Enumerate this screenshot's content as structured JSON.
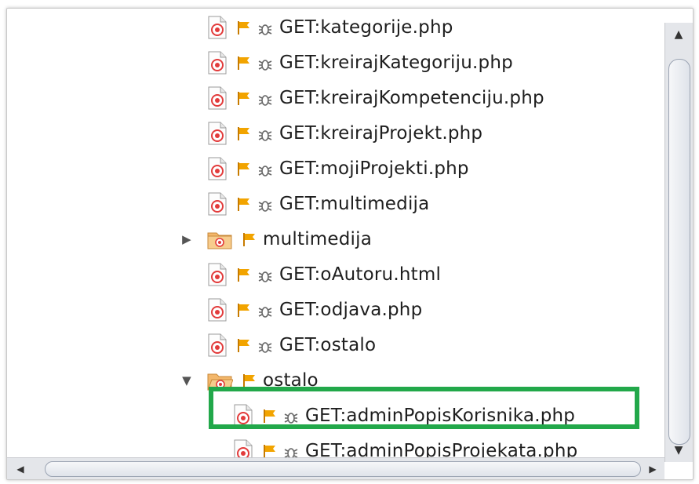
{
  "tree": {
    "rows": [
      {
        "label": "GET:kategorije.php",
        "type": "file",
        "icons": [
          "page-target-icon",
          "flag-icon",
          "bug-icon"
        ]
      },
      {
        "label": "GET:kreirajKategoriju.php",
        "type": "file",
        "icons": [
          "page-target-icon",
          "flag-icon",
          "bug-icon"
        ]
      },
      {
        "label": "GET:kreirajKompetenciju.php",
        "type": "file",
        "icons": [
          "page-target-icon",
          "flag-icon",
          "bug-icon"
        ]
      },
      {
        "label": "GET:kreirajProjekt.php",
        "type": "file",
        "icons": [
          "page-target-icon",
          "flag-icon",
          "bug-icon"
        ]
      },
      {
        "label": "GET:mojiProjekti.php",
        "type": "file",
        "icons": [
          "page-target-icon",
          "flag-icon",
          "bug-icon"
        ]
      },
      {
        "label": "GET:multimedija",
        "type": "file",
        "icons": [
          "page-target-icon",
          "flag-icon",
          "bug-icon"
        ]
      },
      {
        "label": "multimedija",
        "type": "folder",
        "expanded": false,
        "icons": [
          "folder-icon",
          "flag-icon"
        ]
      },
      {
        "label": "GET:oAutoru.html",
        "type": "file",
        "icons": [
          "page-target-icon",
          "flag-icon",
          "bug-icon"
        ]
      },
      {
        "label": "GET:odjava.php",
        "type": "file",
        "icons": [
          "page-target-icon",
          "flag-icon",
          "bug-icon"
        ]
      },
      {
        "label": "GET:ostalo",
        "type": "file",
        "icons": [
          "page-target-icon",
          "flag-icon",
          "bug-icon"
        ]
      },
      {
        "label": "ostalo",
        "type": "folder",
        "expanded": true,
        "icons": [
          "folder-open-icon",
          "flag-icon"
        ]
      },
      {
        "label": "GET:adminPopisKorisnika.php",
        "type": "file",
        "highlighted": true,
        "icons": [
          "page-target-icon",
          "flag-icon",
          "bug-icon"
        ]
      },
      {
        "label": "GET:adminPopisProjekata.php",
        "type": "file",
        "icons": [
          "page-target-icon",
          "flag-icon",
          "bug-icon"
        ]
      }
    ]
  },
  "colors": {
    "highlight_border": "#22a84a",
    "flag": "#f2a400",
    "target": "#e23b3b",
    "folder": "#f3b76b"
  },
  "scrollbars": {
    "up_arrow": "▲",
    "down_arrow": "▼",
    "left_arrow": "◀",
    "right_arrow": "▶"
  }
}
